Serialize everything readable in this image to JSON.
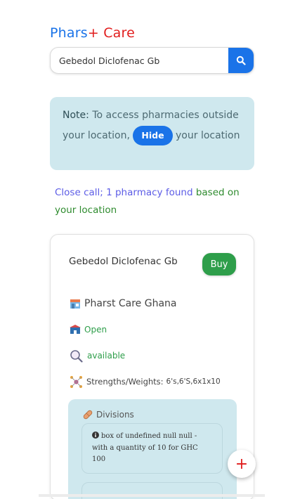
{
  "header": {
    "logo_part1": "Phars",
    "logo_part2": "+ Care"
  },
  "search": {
    "value": "Gebedol Diclofenac Gb",
    "placeholder": ""
  },
  "note": {
    "label": "Note:",
    "text_before": "To access pharmacies outside your location,",
    "hide_button": "Hide",
    "text_after": "your location"
  },
  "result": {
    "summary": "Close call; 1 pharmacy found",
    "summary_suffix": "based on your location"
  },
  "card": {
    "drug_name": "Gebedol Diclofenac Gb",
    "buy_label": "Buy",
    "pharmacy_name": "Pharst Care Ghana",
    "status": "Open",
    "availability": "available",
    "strengths_label": "Strengths/Weights:",
    "strengths_value": "6's,6'S,6x1x10",
    "divisions_title": "Divisions",
    "division_text": "box of undefined null null - with a quantity of 10 for GHC 100"
  },
  "fab": {
    "label": "+"
  },
  "colors": {
    "brand_blue": "#1a73e8",
    "brand_red": "#e11d1d",
    "green": "#2e9e4a",
    "note_bg": "#cfe8ee"
  }
}
